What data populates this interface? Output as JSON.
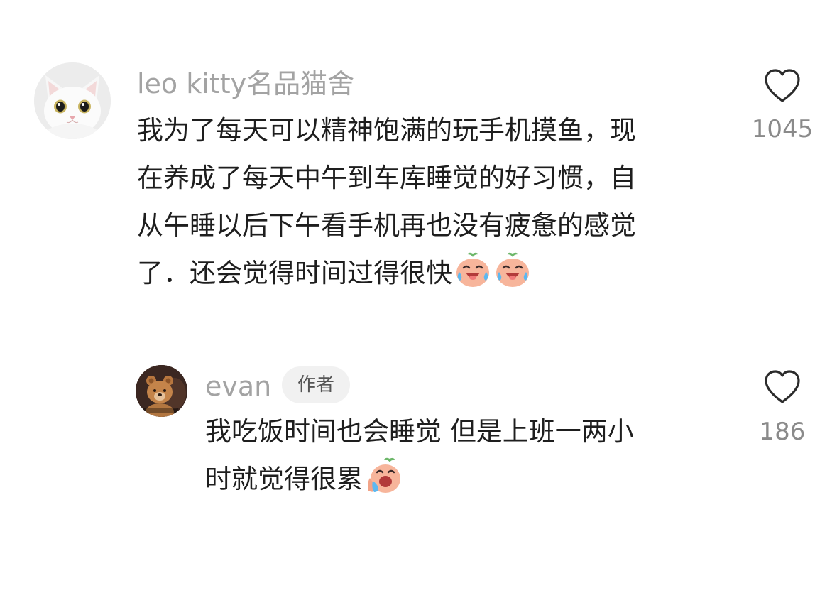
{
  "comment": {
    "username": "leo kitty名品猫舍",
    "avatar_icon": "white-cat-avatar",
    "lines": [
      "我为了每天可以精神饱满的玩手机摸鱼，现",
      "在养成了每天中午到车库睡觉的好习惯，自",
      "从午睡以后下午看手机再也没有疲惫的感觉",
      "了．还会觉得时间过得很快"
    ],
    "emojis": [
      "laugh-cry-peach-emoji",
      "laugh-cry-peach-emoji"
    ],
    "like_icon": "heart-outline-icon",
    "like_count": "1045"
  },
  "reply": {
    "username": "evan",
    "author_badge": "作者",
    "avatar_icon": "teddy-bear-avatar",
    "lines": [
      "我吃饭时间也会睡觉 但是上班一两小",
      "时就觉得很累"
    ],
    "emojis": [
      "crying-peach-emoji"
    ],
    "like_icon": "heart-outline-icon",
    "like_count": "186"
  },
  "colors": {
    "username": "#a3a3a3",
    "text": "#1e1e1e",
    "like_count": "#8a8a8a",
    "badge_background": "#f1f1f1",
    "peach": "#f7b59b"
  }
}
